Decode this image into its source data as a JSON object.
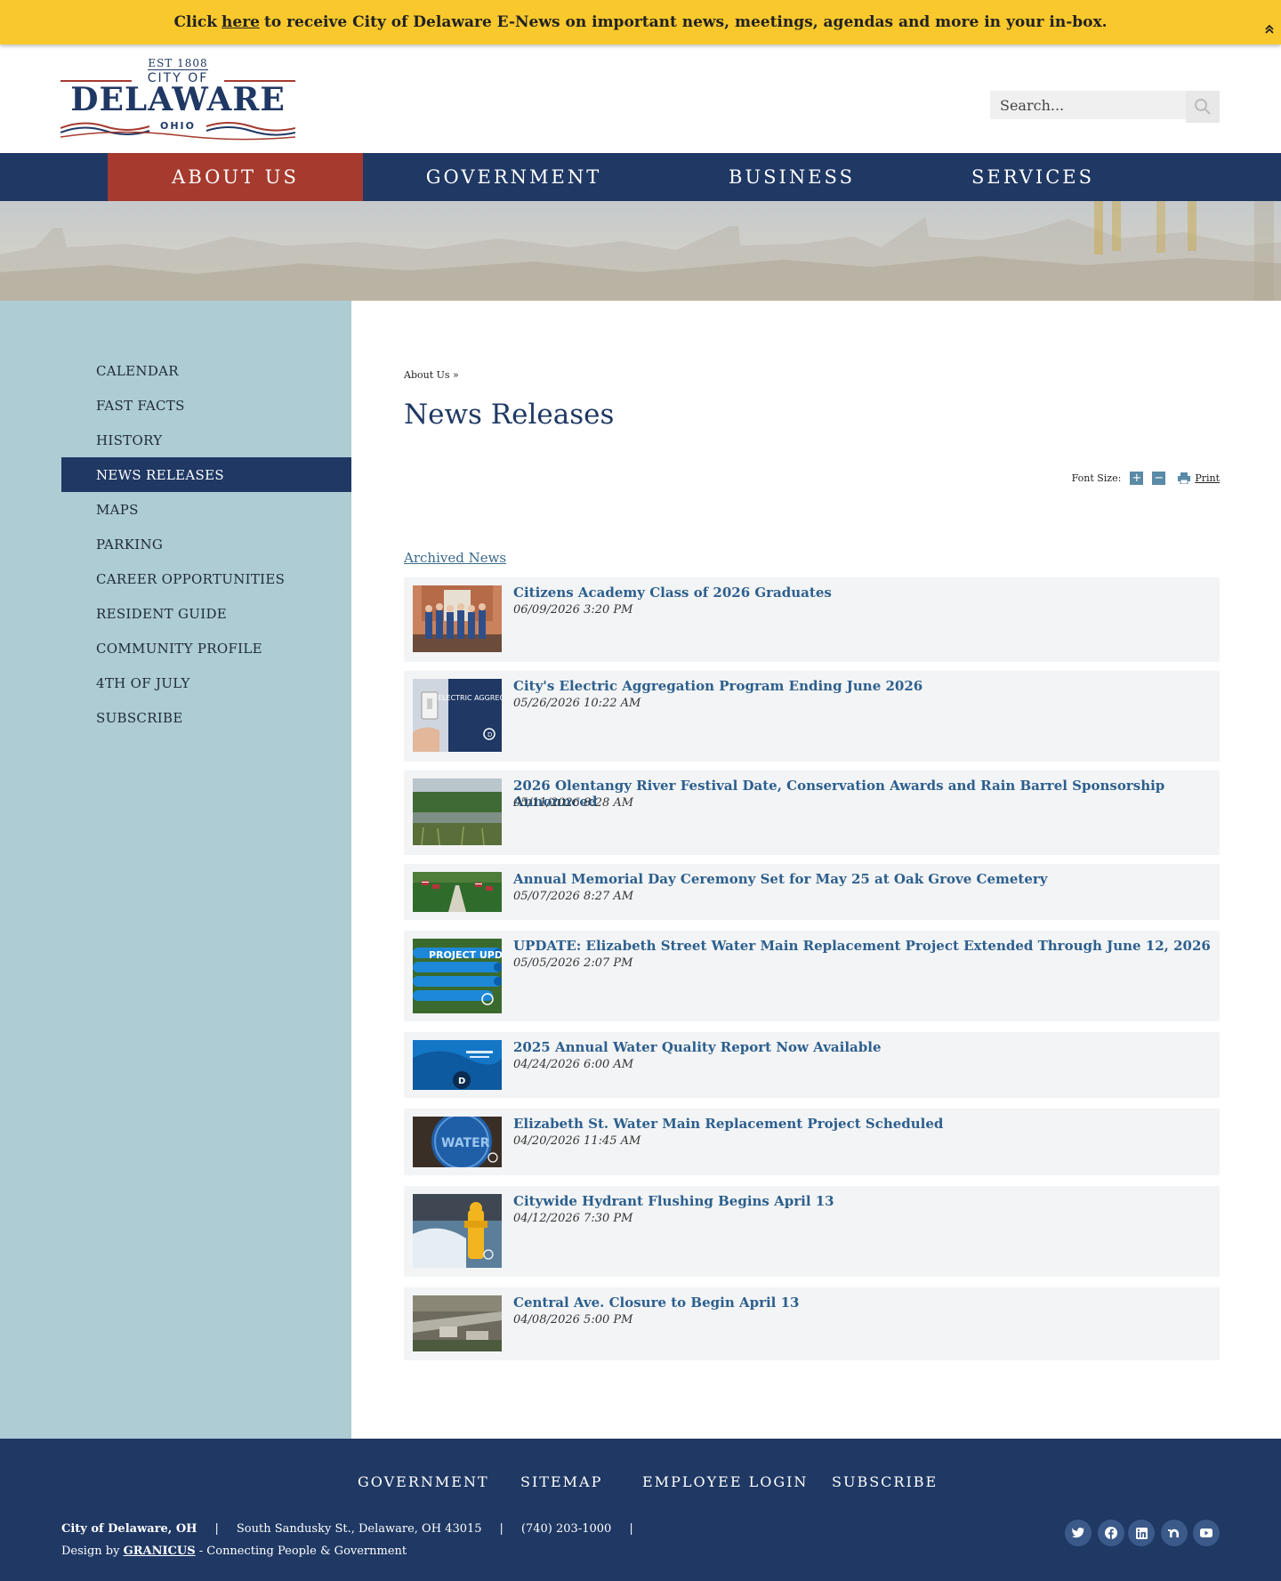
{
  "alert": {
    "prefix": "Click",
    "link": "here",
    "suffix": "to receive City of Delaware E-News on important news, meetings, agendas and more in your in-box."
  },
  "logo": {
    "est": "EST 1808",
    "city_of": "CITY OF",
    "name": "DELAWARE",
    "state": "OHIO"
  },
  "search": {
    "placeholder": "Search..."
  },
  "nav": {
    "items": [
      {
        "label": "ABOUT US"
      },
      {
        "label": "GOVERNMENT"
      },
      {
        "label": "BUSINESS"
      },
      {
        "label": "SERVICES"
      }
    ]
  },
  "sidebar": {
    "items": [
      {
        "label": "CALENDAR"
      },
      {
        "label": "FAST FACTS"
      },
      {
        "label": "HISTORY"
      },
      {
        "label": "NEWS RELEASES"
      },
      {
        "label": "MAPS"
      },
      {
        "label": "PARKING"
      },
      {
        "label": "CAREER OPPORTUNITIES"
      },
      {
        "label": "RESIDENT GUIDE"
      },
      {
        "label": "COMMUNITY PROFILE"
      },
      {
        "label": "4TH OF JULY"
      },
      {
        "label": "SUBSCRIBE"
      }
    ]
  },
  "main": {
    "breadcrumb": "About Us »",
    "title": "News Releases",
    "tools": {
      "font_size_label": "Font Size:",
      "increase": "+",
      "decrease": "−",
      "print": "Print"
    },
    "archived_link": "Archived News",
    "news": [
      {
        "title": "Citizens Academy Class of 2026 Graduates",
        "date": "06/09/2026 3:20 PM",
        "thumb": "group-photo-thumbnail"
      },
      {
        "title": "City's Electric Aggregation Program Ending June 2026",
        "date": "05/26/2026 10:22 AM",
        "thumb": "electric-aggregation-thumbnail",
        "thumb_text": "ELECTRIC AGGREGATION UPDATE"
      },
      {
        "title": "2026 Olentangy River Festival Date, Conservation Awards and Rain Barrel Sponsorship Announced",
        "date": "05/11/2026 8:28 AM",
        "thumb": "river-thumbnail"
      },
      {
        "title": "Annual Memorial Day Ceremony Set for May 25 at Oak Grove Cemetery",
        "date": "05/07/2026 8:27 AM",
        "thumb": "cemetery-flags-thumbnail"
      },
      {
        "title": "UPDATE: Elizabeth Street Water Main Replacement Project Extended Through June 12, 2026",
        "date": "05/05/2026 2:07 PM",
        "thumb": "project-update-thumbnail",
        "thumb_text": "PROJECT UPDATE"
      },
      {
        "title": "2025 Annual Water Quality Report Now Available",
        "date": "04/24/2026 6:00 AM",
        "thumb": "water-report-thumbnail"
      },
      {
        "title": "Elizabeth St. Water Main Replacement Project Scheduled",
        "date": "04/20/2026 11:45 AM",
        "thumb": "water-cover-thumbnail",
        "thumb_text": "WATER"
      },
      {
        "title": "Citywide Hydrant Flushing Begins April 13",
        "date": "04/12/2026 7:30 PM",
        "thumb": "hydrant-thumbnail"
      },
      {
        "title": "Central Ave. Closure to Begin April 13",
        "date": "04/08/2026 5:00 PM",
        "thumb": "aerial-road-thumbnail"
      }
    ]
  },
  "footer": {
    "links": [
      {
        "label": "GOVERNMENT"
      },
      {
        "label": "SITEMAP"
      },
      {
        "label": "EMPLOYEE LOGIN"
      },
      {
        "label": "SUBSCRIBE"
      }
    ],
    "org": "City of Delaware, OH",
    "address": "South Sandusky St., Delaware, OH 43015",
    "phone": "(740) 203-1000",
    "separator": "|",
    "design_prefix": "Design by",
    "design_link": "GRANICUS",
    "design_suffix": "- Connecting People & Government",
    "social": [
      "twitter-icon",
      "facebook-icon",
      "linkedin-icon",
      "nextdoor-icon",
      "youtube-icon"
    ]
  },
  "colors": {
    "alert_bg": "#f9c82c",
    "navy": "#1f3864",
    "nav_active": "#a63a2f",
    "sidebar_bg": "#adccd3",
    "news_title": "#2c5f8e",
    "news_bg": "#f3f4f5"
  }
}
